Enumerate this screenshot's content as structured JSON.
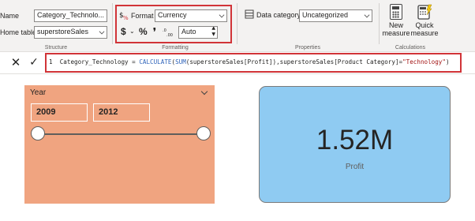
{
  "structure": {
    "name_label": "Name",
    "name_value": "Category_Technolo...",
    "home_table_label": "Home table",
    "home_table_value": "superstoreSales",
    "group_label": "Structure"
  },
  "formatting": {
    "format_label": "Format",
    "format_value": "Currency",
    "currency_symbol": "$",
    "percent_symbol": "%",
    "comma_symbol": "❜",
    "decimals_value": "Auto",
    "group_label": "Formatting"
  },
  "properties": {
    "data_category_label": "Data category",
    "data_category_value": "Uncategorized",
    "group_label": "Properties"
  },
  "calculations": {
    "new_measure_label_1": "New",
    "new_measure_label_2": "measure",
    "quick_measure_label_1": "Quick",
    "quick_measure_label_2": "measure",
    "group_label": "Calculations"
  },
  "formula_bar": {
    "cancel_glyph": "✕",
    "commit_glyph": "✓",
    "line_number": "1",
    "measure_name": "Category_Technology",
    "equals": " = ",
    "fn_calculate": "CALCULATE",
    "open_paren": "(",
    "fn_sum": "SUM",
    "sum_arg": "(superstoreSales[Profit]),superstoreSales[Product Category]=",
    "string_literal": "\"Technology\"",
    "close_paren": ")"
  },
  "slicer": {
    "title": "Year",
    "start_value": "2009",
    "end_value": "2012",
    "range_fill": 1.0,
    "background_color": "#f0a480"
  },
  "card": {
    "value": "1.52M",
    "label": "Profit",
    "background_color": "#8fcbf2"
  },
  "icons": {
    "format_icon": "format-icon",
    "data_category_icon": "data-category-icon",
    "new_measure_icon": "calculator-icon",
    "quick_measure_icon": "quick-measure-icon",
    "slicer_expand_icon": "chevron-down-icon"
  },
  "colors": {
    "highlight_border": "#d13438",
    "ribbon_bg": "#f3f2f1",
    "dax_function": "#3165bb",
    "dax_string": "#a31515"
  }
}
